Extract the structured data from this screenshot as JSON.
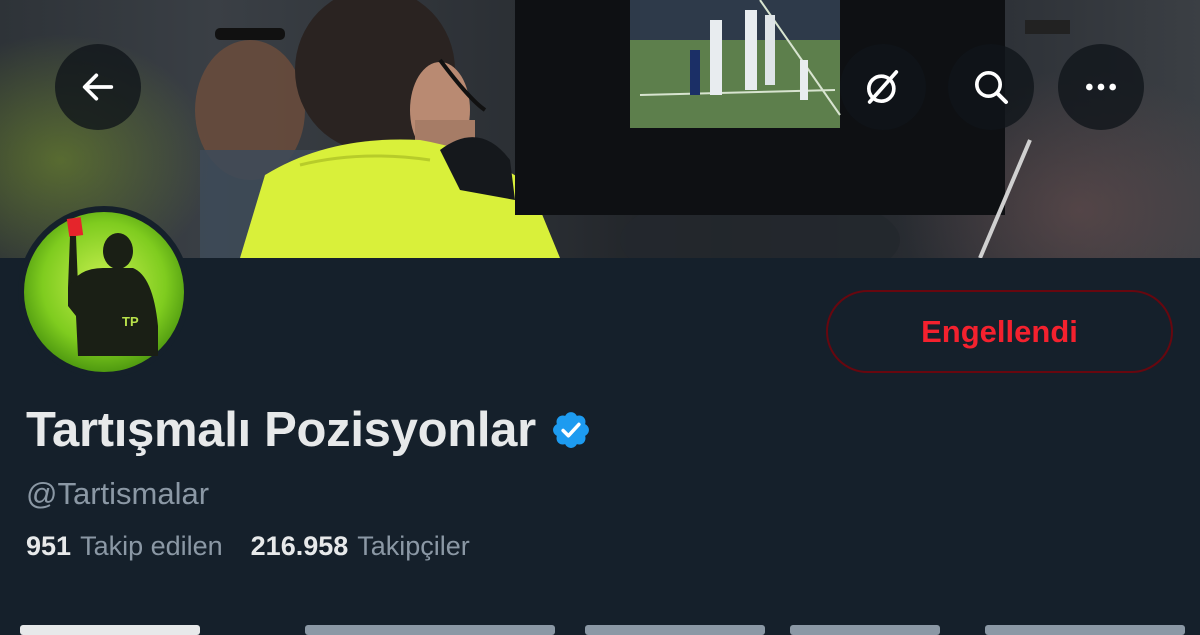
{
  "header": {
    "back_icon": "arrow-left-icon",
    "grok_icon": "grok-icon",
    "search_icon": "search-icon",
    "more_icon": "more-horizontal-icon"
  },
  "banner": {
    "description_icon": "referee-var-screen-photo"
  },
  "profile": {
    "avatar_icon": "referee-red-card-avatar",
    "avatar_text": "TP",
    "display_name": "Tartışmalı Pozisyonlar",
    "verified_icon": "verified-badge-icon",
    "handle": "@Tartismalar",
    "block_button_label": "Engellendi",
    "following_count": "951",
    "following_label": "Takip edilen",
    "followers_count": "216.958",
    "followers_label": "Takipçiler"
  },
  "colors": {
    "background": "#15202b",
    "text_primary": "#e7e9ea",
    "text_secondary": "#8b98a5",
    "blocked_red": "#f4212e",
    "blocked_border": "#67070f",
    "verified_blue": "#1d9bf0"
  }
}
